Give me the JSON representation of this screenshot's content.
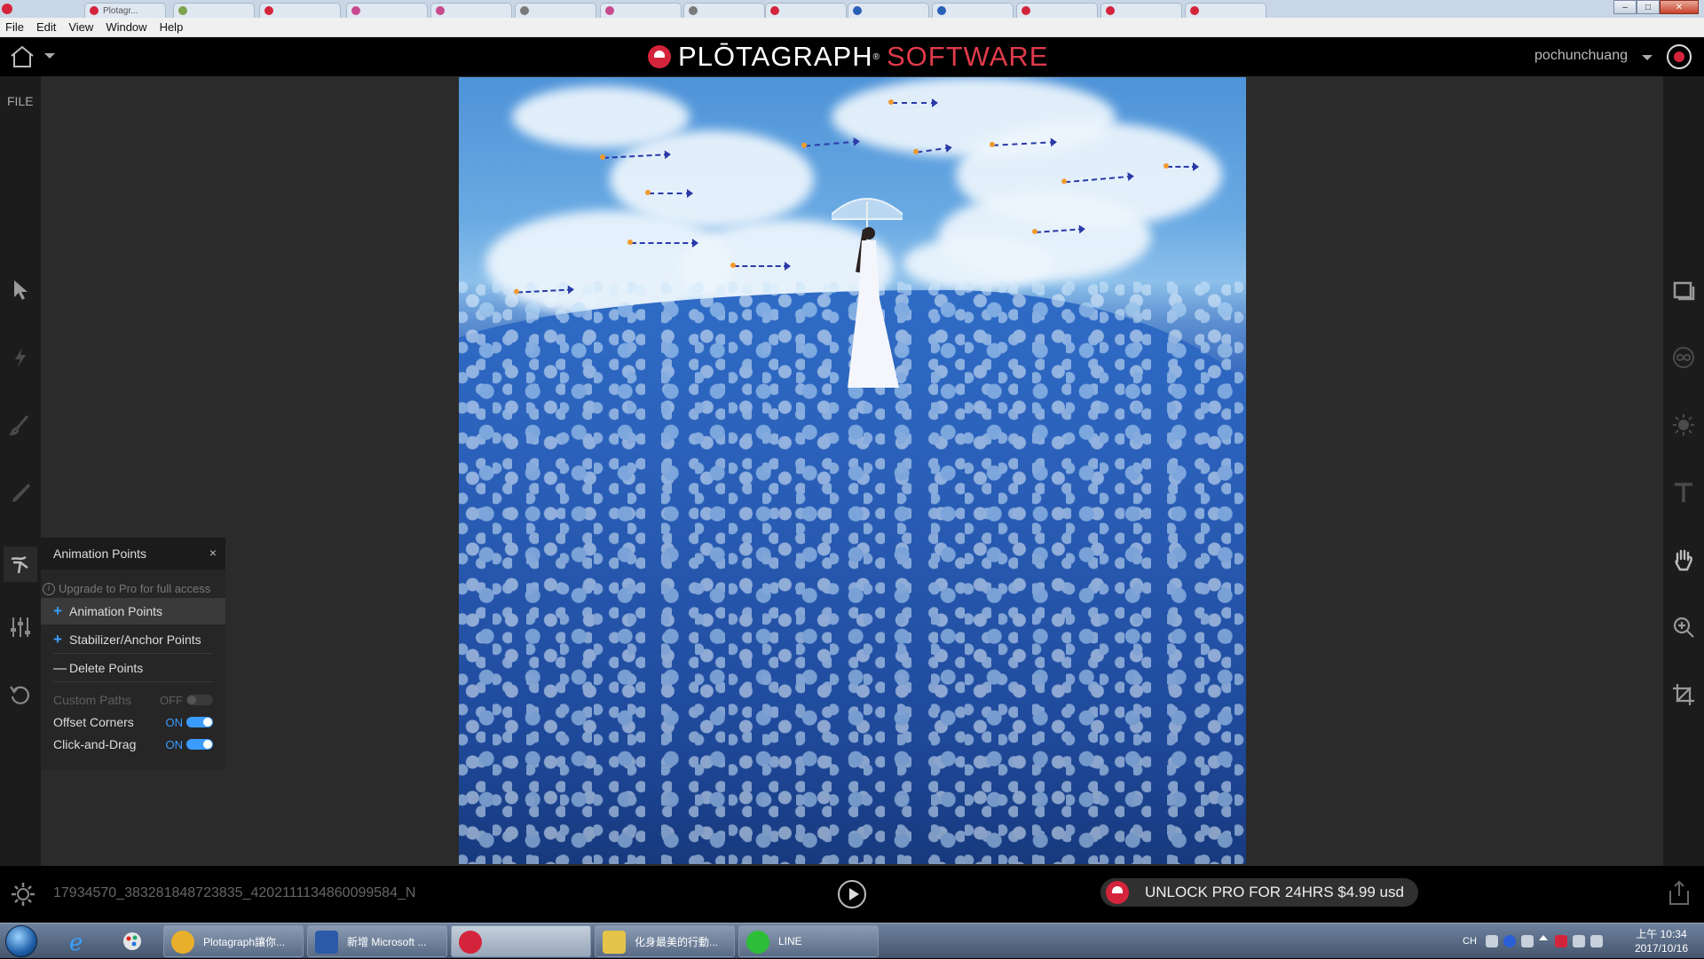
{
  "browser_tabs": [
    {
      "label": "Plotagr...",
      "color": "#d4243b"
    },
    {
      "label": "",
      "color": "#7aa34a"
    },
    {
      "label": "",
      "color": "#d4243b"
    },
    {
      "label": "",
      "color": "#c84a8e"
    },
    {
      "label": "",
      "color": "#c84a8e"
    },
    {
      "label": "",
      "color": "#7a7a7a"
    },
    {
      "label": "",
      "color": "#c84a8e"
    },
    {
      "label": "",
      "color": "#7a7a7a"
    },
    {
      "label": "",
      "color": "#d4243b"
    },
    {
      "label": "",
      "color": "#2a5fb8"
    },
    {
      "label": "",
      "color": "#2a5fb8"
    },
    {
      "label": "",
      "color": "#d4243b"
    },
    {
      "label": "",
      "color": "#d4243b"
    },
    {
      "label": "",
      "color": "#d4243b"
    }
  ],
  "menu": [
    "File",
    "Edit",
    "View",
    "Window",
    "Help"
  ],
  "header": {
    "logo_primary": "PLŌTAGRAPH",
    "logo_reg": "®",
    "logo_secondary": "SOFTWARE",
    "username": "pochunchuang",
    "brand_color": "#d4243b",
    "accent_red": "#e03a4b"
  },
  "left_toolbar": {
    "file_label": "FILE",
    "tools": [
      "select-arrow-icon",
      "lightning-icon",
      "brush-icon",
      "pen-icon",
      "animation-points-icon",
      "sliders-icon",
      "undo-icon"
    ]
  },
  "right_toolbar": {
    "tools": [
      "overlay-icon",
      "loop-icon",
      "brightness-icon",
      "text-icon",
      "hand-icon",
      "zoom-icon",
      "crop-icon"
    ]
  },
  "panel": {
    "title": "Animation Points",
    "close": "×",
    "note": "Upgrade to Pro for full access",
    "items": [
      {
        "label": "Animation Points",
        "icon": "plus",
        "active": true
      },
      {
        "label": "Stabilizer/Anchor Points",
        "icon": "plus",
        "active": false
      },
      {
        "label": "Delete Points",
        "icon": "minus",
        "active": false
      }
    ],
    "toggles": [
      {
        "label": "Custom Paths",
        "state": "OFF",
        "enabled": false
      },
      {
        "label": "Offset Corners",
        "state": "ON",
        "enabled": true
      },
      {
        "label": "Click-and-Drag",
        "state": "ON",
        "enabled": true
      }
    ],
    "accent": "#3b9cff"
  },
  "bottom": {
    "file_name": "17934570_383281848723835_4202111134860099584_N",
    "unlock_label": "UNLOCK PRO FOR 24HRS $4.99 usd"
  },
  "taskbar": {
    "buttons": [
      {
        "label": "Plotagraph讓你...",
        "color": "#e8b02a"
      },
      {
        "label": "新增 Microsoft ...",
        "color": "#2b5aa8"
      },
      {
        "label": "",
        "color": "#d4243b"
      },
      {
        "label": "化身最美的行動...",
        "color": "#e6c44a"
      },
      {
        "label": "LINE",
        "color": "#2fbe3a"
      }
    ],
    "lang": "CH",
    "time": "上午 10:34",
    "date": "2017/10/16"
  }
}
